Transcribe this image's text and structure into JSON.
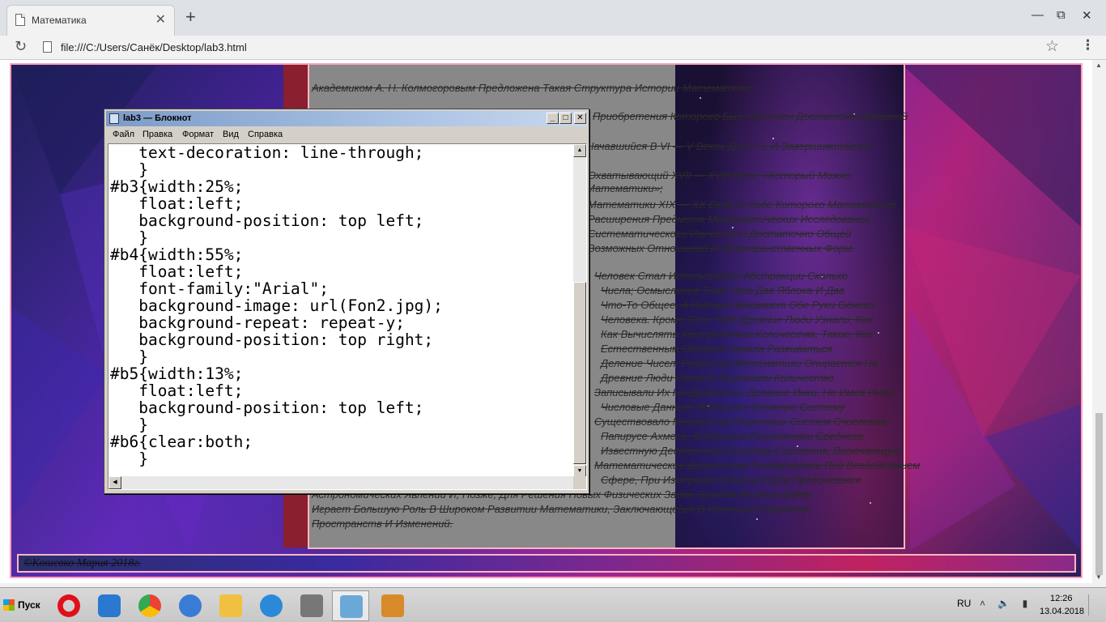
{
  "browser": {
    "tab_title": "Математика",
    "tab_close": "✕",
    "new_tab": "+",
    "window_controls": {
      "minimize": "—",
      "restore": "⧉",
      "close": "✕"
    },
    "reload_icon": "↻",
    "url": "file:///C:/Users/Санёк/Desktop/lab3.html",
    "star_icon": "☆",
    "menu_icon": "⋮"
  },
  "page": {
    "paragraphs": [
      "Академиком А. Н. Колмогоровым Предложена Такая Структура Истории Математики:",
      "Приобретения Которого Был Накоплен Достаточно Большой",
      "Начавшийся В VI — V Веках До Н. Э. И Завершившийся В",
      "Охватывающий XVII — XVIII Века, «Который Можно",
      "Математики»;",
      "Математики XIX — XX Века, В Ходе Которого Математики",
      "Расширения Предмета Математических Исследований",
      "Систематического Изучения С Достаточно Общей",
      "Возможных Отношений И Пространственных Форм.",
      "Человек Стал Использовать Абстракции Сколько",
      "Числа; Осмысление Того, Что Два Яблока И Два",
      "Что-То Общее, А Именно Занимают Обе Руки Одного",
      "Человека. Кроме Того, Что Древние Люди Узнали, Как",
      "Как Вычислять Абстрактные Количества, Такие, Как",
      "Естественным Образом Начала Развиваться",
      "Деление Чисел. Развитие Математики Опирается На",
      "Древние Люди Сначала Выражали Количество",
      "Записывали Их На Древесине. Древние Инки, Не Имея Иной",
      "Числовые Данные, Используя Сложную Систему",
      "Существовало Множество Различных Систем Счисления.",
      "Папирусе Ахмеса, Созданном Египтянами Среднего",
      "Известную Десятичную Систему Счисления, Включающую",
      "Математические Дисциплины Подвергались Под Воздействием",
      "Сфере, При Измерении Земель И Для Предсказания",
      "Астрономических Явлений И, Позже, Для Решения Новых Физических Задач. Каждая Из Этих Сфер",
      "Играет Большую Роль В Широком Развитии Математики, Заключающейся В Изучении Структур,",
      "Пространств И Изменений."
    ],
    "footer": "©Кошевко Мария 2018г."
  },
  "notepad": {
    "title": "lab3 — Блокнот",
    "menu": [
      "Файл",
      "Правка",
      "Формат",
      "Вид",
      "Справка"
    ],
    "buttons": {
      "minimize": "_",
      "maximize": "□",
      "close": "✕"
    },
    "content": "   text-decoration: line-through;\n   }\n#b3{width:25%;\n   float:left;\n   background-position: top left;\n   }\n#b4{width:55%;\n   float:left;\n   font-family:\"Arial\";\n   background-image: url(Fon2.jpg);\n   background-repeat: repeat-y;\n   background-position: top right;\n   }\n#b5{width:13%;\n   float:left;\n   background-position: top left;\n   }\n#b6{clear:both;\n   }"
  },
  "taskbar": {
    "start_label": "Пуск",
    "apps": [
      {
        "name": "opera",
        "color": "#e0101a"
      },
      {
        "name": "media-player",
        "color": "#2a78d0"
      },
      {
        "name": "chrome",
        "color": "#34a853"
      },
      {
        "name": "volume",
        "color": "#3a7bd5"
      },
      {
        "name": "explorer",
        "color": "#f0c040"
      },
      {
        "name": "messenger",
        "color": "#2a8ad8"
      },
      {
        "name": "news",
        "color": "#777777"
      },
      {
        "name": "notepad",
        "color": "#6aa8d8"
      },
      {
        "name": "paint",
        "color": "#d88a2a"
      }
    ],
    "language": "RU",
    "tray": "˄ 🔈 ▮",
    "time": "12:26",
    "date": "13.04.2018"
  }
}
